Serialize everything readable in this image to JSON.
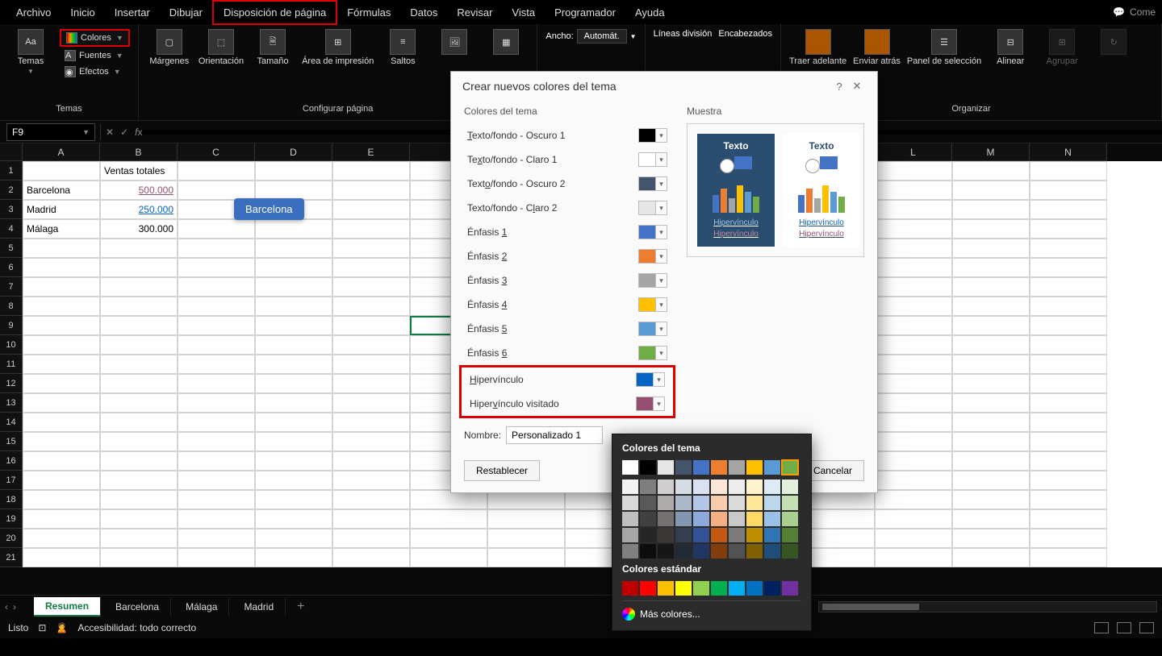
{
  "menu": {
    "items": [
      "Archivo",
      "Inicio",
      "Insertar",
      "Dibujar",
      "Disposición de página",
      "Fórmulas",
      "Datos",
      "Revisar",
      "Vista",
      "Programador",
      "Ayuda"
    ],
    "active_index": 4,
    "right_label": "Come"
  },
  "ribbon": {
    "temas": {
      "label": "Temas",
      "btn": "Temas",
      "colores": "Colores",
      "fuentes": "Fuentes",
      "efectos": "Efectos"
    },
    "configurar": {
      "label": "Configurar página",
      "margenes": "Márgenes",
      "orientacion": "Orientación",
      "tamano": "Tamaño",
      "area": "Área de impresión",
      "saltos": "Saltos"
    },
    "ajustar": {
      "ancho_label": "Ancho:",
      "ancho_val": "Automát."
    },
    "opciones_hoja": {
      "lineas": "Líneas división",
      "encabezados": "Encabezados"
    },
    "organizar": {
      "label": "Organizar",
      "traer": "Traer adelante",
      "enviar": "Enviar atrás",
      "panel": "Panel de selección",
      "alinear": "Alinear",
      "agrupar": "Agrupar"
    }
  },
  "namebox": "F9",
  "sheet_data": {
    "header": "Ventas totales",
    "tooltip": "Barcelona",
    "rows": [
      {
        "a": "Barcelona",
        "b": "500.000",
        "cls": "vlink"
      },
      {
        "a": "Madrid",
        "b": "250.000",
        "cls": "link"
      },
      {
        "a": "Málaga",
        "b": "300.000",
        "cls": "num"
      }
    ],
    "col_headers": [
      "A",
      "B",
      "C",
      "D",
      "E",
      "",
      "",
      "",
      "",
      "",
      "",
      "L",
      "M",
      "N"
    ],
    "visible_rows": 21
  },
  "sheets": {
    "tabs": [
      "Resumen",
      "Barcelona",
      "Málaga",
      "Madrid"
    ],
    "active": 0
  },
  "status": {
    "ready": "Listo",
    "accessibility": "Accesibilidad: todo correcto"
  },
  "dialog": {
    "title": "Crear nuevos colores del tema",
    "left_title": "Colores del tema",
    "right_title": "Muestra",
    "rows": [
      {
        "label": "Texto/fondo - Oscuro 1",
        "u": "T",
        "color": "#000000"
      },
      {
        "label": "Texto/fondo - Claro 1",
        "u": "x",
        "color": "#ffffff"
      },
      {
        "label": "Texto/fondo - Oscuro 2",
        "u": "O",
        "color": "#44546a"
      },
      {
        "label": "Texto/fondo - Claro 2",
        "u": "l",
        "color": "#e7e6e6"
      },
      {
        "label": "Énfasis 1",
        "u": "1",
        "color": "#4472c4"
      },
      {
        "label": "Énfasis 2",
        "u": "2",
        "color": "#ed7d31"
      },
      {
        "label": "Énfasis 3",
        "u": "3",
        "color": "#a5a5a5"
      },
      {
        "label": "Énfasis 4",
        "u": "4",
        "color": "#ffc000"
      },
      {
        "label": "Énfasis 5",
        "u": "5",
        "color": "#5b9bd5"
      },
      {
        "label": "Énfasis 6",
        "u": "6",
        "color": "#70ad47"
      },
      {
        "label": "Hipervínculo",
        "u": "H",
        "color": "#0563c1",
        "red": true
      },
      {
        "label": "Hipervínculo visitado",
        "u": "v",
        "color": "#954f72",
        "red": true
      }
    ],
    "nombre_label": "Nombre:",
    "nombre_value": "Personalizado 1",
    "restablecer": "Restablecer",
    "cancelar": "Cancelar",
    "preview": {
      "texto": "Texto",
      "hyper": "Hipervínculo",
      "vhyper": "Hipervínculo"
    }
  },
  "picker": {
    "title1": "Colores del tema",
    "title2": "Colores estándar",
    "more": "Más colores...",
    "theme_row": [
      "#ffffff",
      "#000000",
      "#e7e6e6",
      "#44546a",
      "#4472c4",
      "#ed7d31",
      "#a5a5a5",
      "#ffc000",
      "#5b9bd5",
      "#70ad47"
    ],
    "tints": [
      [
        "#f2f2f2",
        "#7f7f7f",
        "#d0cece",
        "#d6dce5",
        "#d9e1f2",
        "#fbe5d6",
        "#ededed",
        "#fff2cc",
        "#ddebf7",
        "#e2efda"
      ],
      [
        "#d9d9d9",
        "#595959",
        "#aeaaaa",
        "#acb9ca",
        "#b4c6e7",
        "#f8cbad",
        "#dbdbdb",
        "#ffe699",
        "#bdd7ee",
        "#c6e0b4"
      ],
      [
        "#bfbfbf",
        "#404040",
        "#767171",
        "#8497b0",
        "#8ea9db",
        "#f4b084",
        "#c9c9c9",
        "#ffd966",
        "#9bc2e6",
        "#a9d08e"
      ],
      [
        "#a6a6a6",
        "#262626",
        "#3b3838",
        "#333f4f",
        "#305496",
        "#c65911",
        "#7b7b7b",
        "#bf8f00",
        "#2f75b5",
        "#548235"
      ],
      [
        "#808080",
        "#0d0d0d",
        "#161616",
        "#222b35",
        "#203764",
        "#833c0c",
        "#525252",
        "#806000",
        "#1f4e78",
        "#375623"
      ]
    ],
    "standard": [
      "#c00000",
      "#ff0000",
      "#ffc000",
      "#ffff00",
      "#92d050",
      "#00b050",
      "#00b0f0",
      "#0070c0",
      "#002060",
      "#7030a0"
    ],
    "selected_theme_idx": 9
  }
}
